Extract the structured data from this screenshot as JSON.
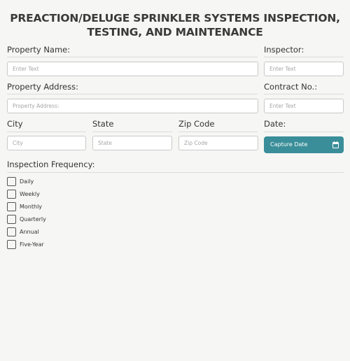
{
  "form": {
    "title_line1": "PREACTION/DELUGE SPRINKLER SYSTEMS INSPECTION,",
    "title_line2": "TESTING, AND MAINTENANCE"
  },
  "fields": {
    "property_name": {
      "label": "Property Name:",
      "placeholder": "Enter Text"
    },
    "inspector": {
      "label": "Inspector:",
      "placeholder": "Enter Text"
    },
    "property_address": {
      "label": "Property Address:",
      "placeholder": "Property Address:"
    },
    "contract_no": {
      "label": "Contract No.:",
      "placeholder": "Enter Text"
    },
    "city": {
      "label": "City",
      "placeholder": "City"
    },
    "state": {
      "label": "State",
      "placeholder": "State"
    },
    "zip": {
      "label": "Zip Code",
      "placeholder": "Zip Code"
    },
    "date": {
      "label": "Date:",
      "button": "Capture Date",
      "icon": "calendar-icon"
    }
  },
  "frequency": {
    "label": "Inspection Frequency:",
    "options": [
      "Daily",
      "Weekly",
      "Monthly",
      "Quarterly",
      "Annual",
      "Five-Year"
    ]
  },
  "colors": {
    "accent": "#3a8e99",
    "background": "#f6f6f4"
  }
}
